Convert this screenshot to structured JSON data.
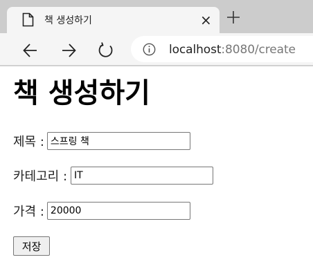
{
  "browser": {
    "tab": {
      "title": "책 생성하기",
      "close_label": "×",
      "page_icon": "page-icon"
    },
    "new_tab_icon": "plus-icon",
    "nav": {
      "back_icon": "arrow-left-icon",
      "forward_icon": "arrow-right-icon",
      "reload_icon": "reload-icon"
    },
    "address": {
      "host": "localhost",
      "path": ":8080/create",
      "info_icon": "info-icon"
    }
  },
  "page": {
    "heading": "책 생성하기",
    "fields": [
      {
        "label": "제목 :",
        "value": "스프링 책"
      },
      {
        "label": "카테고리 :",
        "value": "IT"
      },
      {
        "label": "가격 :",
        "value": "20000"
      }
    ],
    "save_label": "저장"
  }
}
